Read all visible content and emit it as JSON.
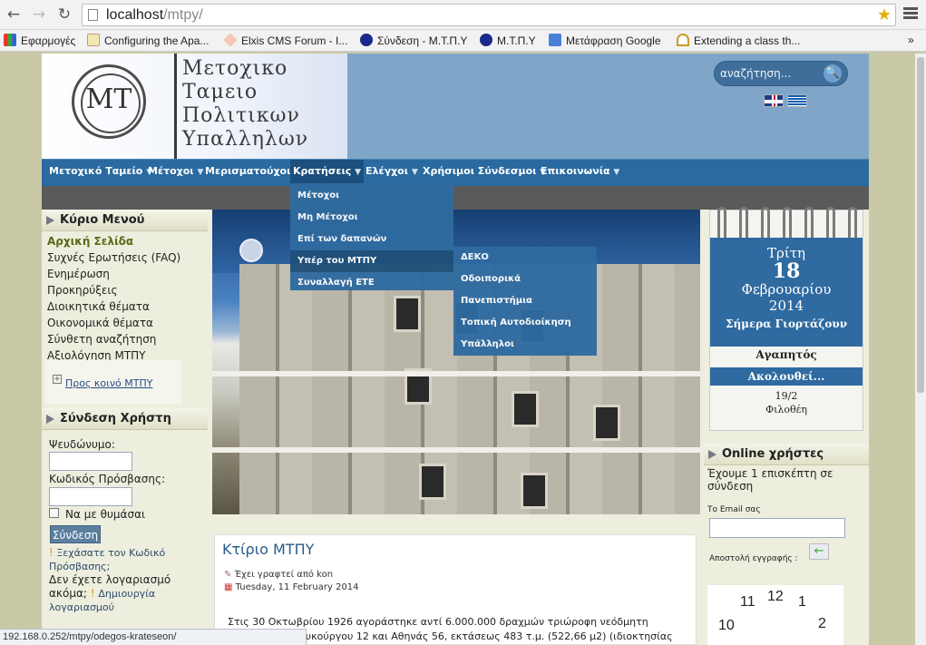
{
  "browser": {
    "url_host": "localhost",
    "url_path": "/mtpy/",
    "bookmarks": [
      "Εφαρμογές",
      "Configuring the Apa...",
      "Elxis CMS Forum - I...",
      "Σύνδεση - Μ.Τ.Π.Υ",
      "Μ.Τ.Π.Υ",
      "Μετάφραση Google",
      "Extending a class th..."
    ],
    "more": "»",
    "status_url": "192.168.0.252/mtpy/odegos-krateseon/"
  },
  "logo": {
    "lines": [
      "Μετοχικο",
      "Ταμειο",
      "Πολιτικων",
      "Υπαλληλων"
    ],
    "mono": "ΜΤ"
  },
  "search": {
    "placeholder": "αναζήτηση..."
  },
  "nav": [
    "Μετοχικό Ταμείο",
    "Μέτοχοι",
    "Μερισματούχοι",
    "Κρατήσεις",
    "Ελέγχοι",
    "Χρήσιμοι Σύνδεσμοι",
    "Επικοινωνία"
  ],
  "dd_arrow": "▼",
  "dropdown": [
    "Μέτοχοι",
    "Μη Μέτοχοι",
    "Επί των δαπανών",
    "Υπέρ του ΜΤΠΥ",
    "Συναλλαγή ΕΤΕ"
  ],
  "dropdown2": [
    "ΔΕΚΟ",
    "Οδοιπορικά",
    "Πανεπιστήμια",
    "Τοπική Αυτοδιοίκηση",
    "Υπάλληλοι"
  ],
  "left": {
    "main_menu_title": "Κύριο Μενού",
    "main_menu": [
      "Αρχική Σελίδα",
      "Συχνές Ερωτήσεις (FAQ)",
      "Ενημέρωση",
      "Προκηρύξεις",
      "Διοικητικά θέματα",
      "Οικονομικά θέματα",
      "Σύνθετη αναζήτηση",
      "Αξιολόγηση ΜΤΠΥ"
    ],
    "faq_link": "Προς κοινό ΜΤΠΥ",
    "login_title": "Σύνδεση Χρήστη",
    "username_label": "Ψευδώνυμο:",
    "password_label": "Κωδικός Πρόσβασης:",
    "remember": "Να με θυμάσαι",
    "login_button": "Σύνδεση",
    "forgot": "Ξεχάσατε τον Κωδικό Πρόσβασης;",
    "no_account": "Δεν έχετε λογαριασμό ακόμα;",
    "register": "Δημιουργία λογαριασμού"
  },
  "article": {
    "title": "Κτίριο ΜΤΠΥ",
    "author": "Έχει γραφτεί από kon",
    "date": "Tuesday, 11 February 2014",
    "body": "Στις 30 Οκτωβρίου 1926 αγοράστηκε αντί 6.000.000 δραχμών τριώροφη νεόδμητη οικοδομή οδό Λυκούργου 12 και Αθηνάς 56, εκτάσεως 483 τ.μ. (522,66 μ2) (ιδιοκτησίας"
  },
  "calendar": {
    "day": "Τρίτη",
    "date": "18",
    "month": "Φεβρουαρίου",
    "year": "2014",
    "feast_title": "Σήμερα Γιορτάζουν",
    "feast": "Αγαπητός",
    "next_title": "Ακολουθεί...",
    "next_date": "19/2",
    "next_name": "Φιλοθέη"
  },
  "online": {
    "title": "Online χρήστες",
    "text": "Έχουμε 1 επισκέπτη σε σύνδεση",
    "email_label": "Το Email σας",
    "subscribe": "Αποστολή εγγραφής :"
  },
  "clock": {
    "n11": "11",
    "n12": "12",
    "n1": "1",
    "n10": "10",
    "n2": "2"
  }
}
